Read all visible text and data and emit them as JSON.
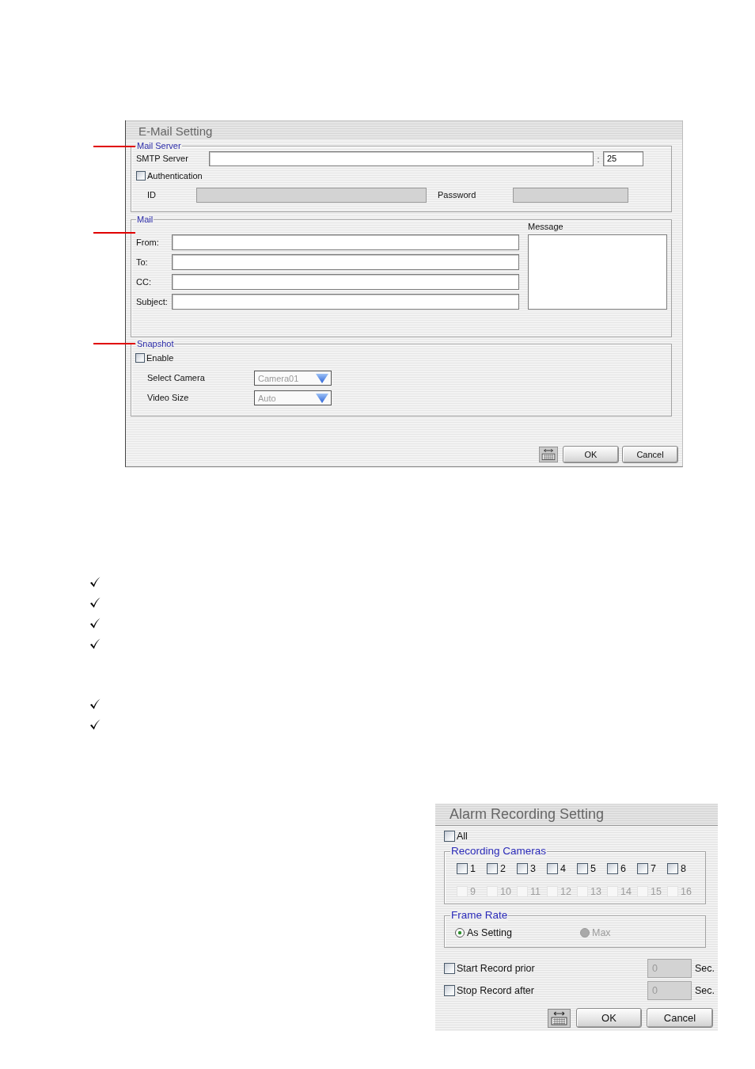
{
  "email_setting": {
    "title": "E-Mail Setting",
    "mail_server": {
      "legend": "Mail Server",
      "smtp": {
        "label": "SMTP Server",
        "separator": ":",
        "port": "25"
      },
      "authentication": {
        "label": "Authentication",
        "checked": false
      },
      "credentials": [
        {
          "label": "ID",
          "disabled": true
        },
        {
          "label": "Password",
          "disabled": true
        }
      ]
    },
    "mail": {
      "legend": "Mail",
      "fields": [
        {
          "label": "From:"
        },
        {
          "label": "To:"
        },
        {
          "label": "CC:"
        },
        {
          "label": "Subject:"
        }
      ],
      "message_label": "Message"
    },
    "snapshot": {
      "legend": "Snapshot",
      "enable": {
        "label": "Enable",
        "checked": false
      },
      "selects": [
        {
          "label": "Select Camera",
          "value": "Camera01",
          "disabled": true
        },
        {
          "label": "Video Size",
          "value": "Auto",
          "disabled": true
        }
      ]
    },
    "buttons": [
      "OK",
      "Cancel"
    ]
  },
  "alarm_recording_setting": {
    "title": "Alarm Recording Setting",
    "all": {
      "label": "All",
      "checked": false
    },
    "recording_cameras": {
      "legend": "Recording Cameras",
      "cameras": [
        {
          "label": "1",
          "checked": false,
          "disabled": false
        },
        {
          "label": "2",
          "checked": false,
          "disabled": false
        },
        {
          "label": "3",
          "checked": false,
          "disabled": false
        },
        {
          "label": "4",
          "checked": false,
          "disabled": false
        },
        {
          "label": "5",
          "checked": false,
          "disabled": false
        },
        {
          "label": "6",
          "checked": false,
          "disabled": false
        },
        {
          "label": "7",
          "checked": false,
          "disabled": false
        },
        {
          "label": "8",
          "checked": false,
          "disabled": false
        },
        {
          "label": "9",
          "checked": false,
          "disabled": true
        },
        {
          "label": "10",
          "checked": false,
          "disabled": true
        },
        {
          "label": "11",
          "checked": false,
          "disabled": true
        },
        {
          "label": "12",
          "checked": false,
          "disabled": true
        },
        {
          "label": "13",
          "checked": false,
          "disabled": true
        },
        {
          "label": "14",
          "checked": false,
          "disabled": true
        },
        {
          "label": "15",
          "checked": false,
          "disabled": true
        },
        {
          "label": "16",
          "checked": false,
          "disabled": true
        }
      ]
    },
    "frame_rate": {
      "legend": "Frame Rate",
      "options": [
        {
          "label": "As Setting",
          "selected": true,
          "disabled": false
        },
        {
          "label": "Max",
          "selected": false,
          "disabled": true
        }
      ]
    },
    "record_times": [
      {
        "label": "Start Record prior",
        "checked": false,
        "value": "0",
        "disabled": true,
        "unit": "Sec."
      },
      {
        "label": "Stop Record after",
        "checked": false,
        "value": "0",
        "disabled": true,
        "unit": "Sec."
      }
    ],
    "buttons": [
      "OK",
      "Cancel"
    ]
  }
}
